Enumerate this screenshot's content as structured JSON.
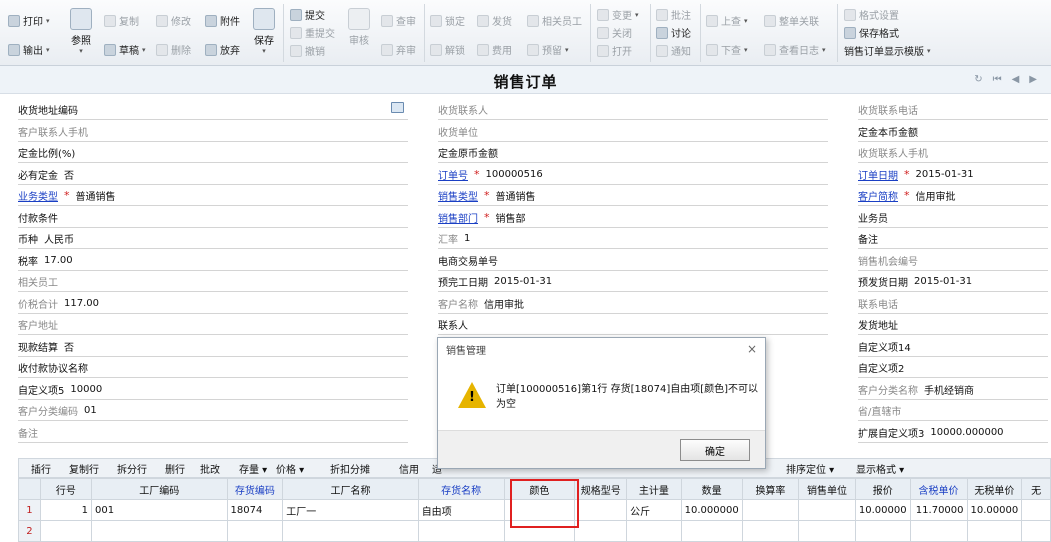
{
  "toolbar": {
    "print": "打印",
    "export": "输出",
    "copy": "复制",
    "modify": "修改",
    "attachment": "附件",
    "save": "保存",
    "submit": "提交",
    "resubmit": "重提交",
    "withdraw": "撤销",
    "audit": "审核",
    "view_audit": "查审",
    "abandon_audit": "弃审",
    "lock": "锁定",
    "unlock": "解锁",
    "ship": "发货",
    "expense": "费用",
    "related_staff": "相关员工",
    "prepay": "预留",
    "change": "变更",
    "close": "关闭",
    "open": "打开",
    "annotate": "批注",
    "discuss": "讨论",
    "notify": "通知",
    "prev": "上查",
    "next": "下查",
    "whole_order_link": "整单关联",
    "view_log": "查看日志",
    "format_settings": "格式设置",
    "save_format": "保存格式",
    "template": "销售订单显示模版",
    "reference": "参照",
    "draft": "草稿",
    "delete": "删除",
    "discard": "放弃"
  },
  "page_title": "销售订单",
  "form": {
    "col1": [
      {
        "label": "收货地址编码",
        "value": "",
        "style": "normal"
      },
      {
        "label": "客户联系人手机",
        "value": "",
        "style": "gray"
      },
      {
        "label": "定金比例(%)",
        "value": "",
        "style": "normal"
      },
      {
        "label": "必有定金",
        "value": "否",
        "style": "normal"
      },
      {
        "label": "业务类型",
        "value": "普通销售",
        "style": "link",
        "required": "*"
      },
      {
        "label": "付款条件",
        "value": "",
        "style": "normal"
      },
      {
        "label": "币种",
        "value": "人民币",
        "style": "normal"
      },
      {
        "label": "税率",
        "value": "17.00",
        "style": "normal"
      },
      {
        "label": "相关员工",
        "value": "",
        "style": "gray"
      },
      {
        "label": "价税合计",
        "value": "117.00",
        "style": "gray"
      },
      {
        "label": "客户地址",
        "value": "",
        "style": "gray"
      },
      {
        "label": "现款结算",
        "value": "否",
        "style": "normal"
      },
      {
        "label": "收付款协议名称",
        "value": "",
        "style": "normal"
      },
      {
        "label": "自定义项5",
        "value": "10000",
        "style": "normal"
      },
      {
        "label": "客户分类编码",
        "value": "01",
        "style": "gray"
      },
      {
        "label": "备注",
        "value": "",
        "style": "gray"
      }
    ],
    "col2": [
      {
        "label": "收货联系人",
        "value": "",
        "style": "gray"
      },
      {
        "label": "收货单位",
        "value": "",
        "style": "gray"
      },
      {
        "label": "定金原币金额",
        "value": "",
        "style": "normal"
      },
      {
        "label": "订单号",
        "value": "100000516",
        "style": "link",
        "required": "*"
      },
      {
        "label": "销售类型",
        "value": "普通销售",
        "style": "link",
        "required": "*"
      },
      {
        "label": "销售部门",
        "value": "销售部",
        "style": "link",
        "required": "*"
      },
      {
        "label": "汇率",
        "value": "1",
        "style": "gray"
      },
      {
        "label": "电商交易单号",
        "value": "",
        "style": "normal"
      },
      {
        "label": "预完工日期",
        "value": "2015-01-31",
        "style": "normal"
      },
      {
        "label": "客户名称",
        "value": "信用审批",
        "style": "gray"
      },
      {
        "label": "联系人",
        "value": "",
        "style": "normal"
      }
    ],
    "col3": [
      {
        "label": "收货联系电话",
        "value": "",
        "style": "gray"
      },
      {
        "label": "定金本币金额",
        "value": "",
        "style": "normal"
      },
      {
        "label": "收货联系人手机",
        "value": "",
        "style": "gray"
      },
      {
        "label": "订单日期",
        "value": "2015-01-31",
        "style": "link",
        "required": "*"
      },
      {
        "label": "客户简称",
        "value": "信用审批",
        "style": "link",
        "required": "*"
      },
      {
        "label": "业务员",
        "value": "",
        "style": "normal"
      },
      {
        "label": "备注",
        "value": "",
        "style": "normal"
      },
      {
        "label": "销售机会编号",
        "value": "",
        "style": "gray"
      },
      {
        "label": "预发货日期",
        "value": "2015-01-31",
        "style": "normal"
      },
      {
        "label": "联系电话",
        "value": "",
        "style": "gray"
      },
      {
        "label": "发货地址",
        "value": "",
        "style": "normal"
      },
      {
        "label": "自定义项14",
        "value": "",
        "style": "normal"
      },
      {
        "label": "自定义项2",
        "value": "",
        "style": "normal"
      },
      {
        "label": "客户分类名称",
        "value": "手机经销商",
        "style": "gray"
      },
      {
        "label": "省/直辖市",
        "value": "",
        "style": "gray"
      },
      {
        "label": "扩展自定义项3",
        "value": "10000.000000",
        "style": "normal"
      }
    ]
  },
  "dialog": {
    "title": "销售管理",
    "message": "订单[100000516]第1行 存货[18074]自由项[颜色]不可以为空",
    "ok": "确定",
    "close": "×"
  },
  "grid_toolbar": {
    "insert": "插行",
    "copy_row": "复制行",
    "split_row": "拆分行",
    "delete_row": "删行",
    "batch_edit": "批改",
    "stock": "存量",
    "price": "价格",
    "discount_split": "折扣分摊",
    "credit": "信用",
    "cut": "适",
    "sort_locate": "排序定位",
    "display_format": "显示格式"
  },
  "grid": {
    "columns": [
      "",
      "行号",
      "工厂编码",
      "存货编码",
      "工厂名称",
      "存货名称",
      "颜色",
      "规格型号",
      "主计量",
      "数量",
      "换算率",
      "销售单位",
      "报价",
      "含税单价",
      "无税单价",
      "无"
    ],
    "rows": [
      [
        "1",
        "1",
        "001",
        "18074",
        "工厂一",
        "自由项",
        "",
        "",
        "公斤",
        "10.000000",
        "",
        "",
        "10.00000",
        "11.70000",
        "10.00000",
        ""
      ],
      [
        "2",
        "",
        "",
        "",
        "",
        "",
        "",
        "",
        "",
        "",
        "",
        "",
        "",
        "",
        "",
        ""
      ]
    ]
  },
  "colors": {
    "link": "#1a3fc4",
    "required": "#d02020",
    "highlight_box": "#e02020",
    "warning": "#e6b400"
  }
}
